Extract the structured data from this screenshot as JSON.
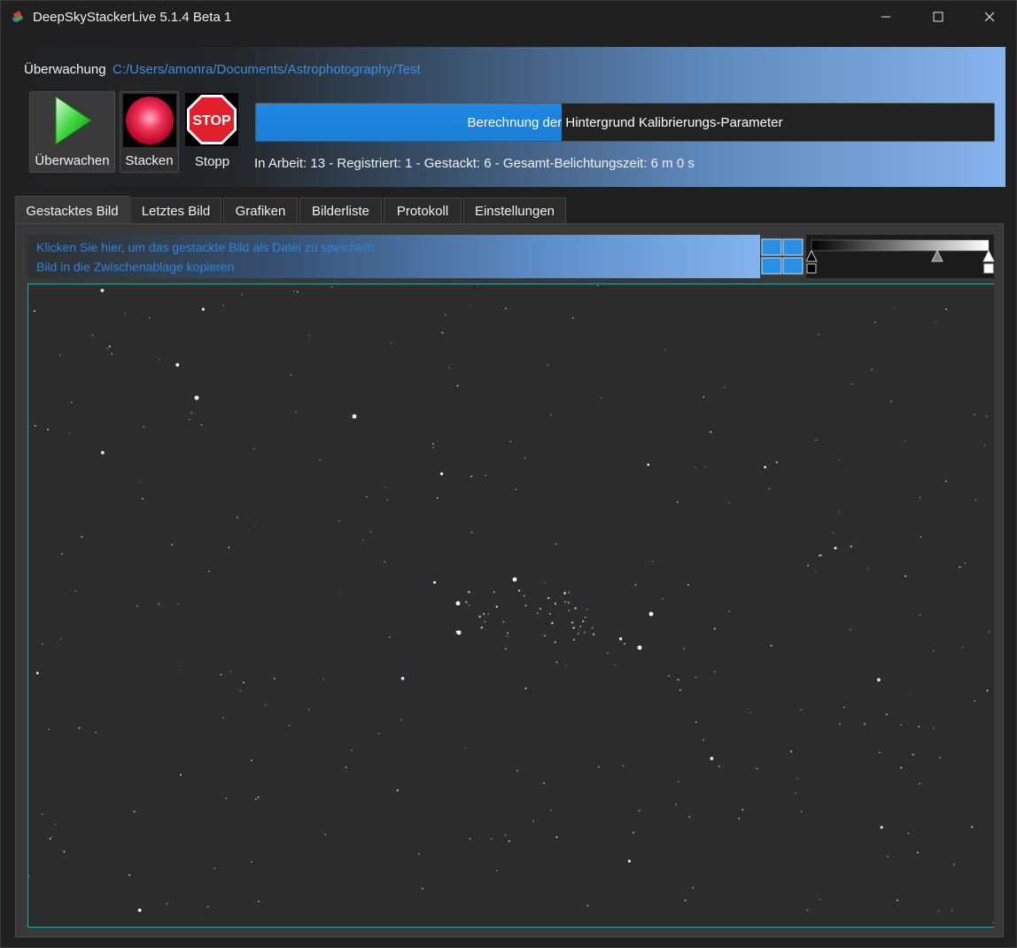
{
  "window": {
    "title": "DeepSkyStackerLive 5.1.4 Beta 1",
    "icons": {
      "logo": "dss-logo-icon",
      "minimize": "minimize-icon",
      "maximize": "maximize-icon",
      "close": "close-icon"
    }
  },
  "monitoring": {
    "label": "Überwachung",
    "folder_path": "C:/Users/amonra/Documents/Astrophotography/Test"
  },
  "toolbar": {
    "watch_label": "Überwachen",
    "stack_label": "Stacken",
    "stop_label": "Stopp",
    "stop_sign_text": "STOP",
    "icons": {
      "watch": "play-icon",
      "stack": "record-icon",
      "stop": "stop-sign-icon"
    }
  },
  "progress": {
    "text": "Berechnung der Hintergrund Kalibrierungs-Parameter",
    "fraction": 0.414
  },
  "status": {
    "text": "In Arbeit: 13 - Registriert: 1 - Gestackt: 6 - Gesamt-Belichtungszeit: 6 m 0 s"
  },
  "tabs": [
    {
      "label": "Gestacktes Bild",
      "active": true
    },
    {
      "label": "Letztes Bild",
      "active": false
    },
    {
      "label": "Grafiken",
      "active": false
    },
    {
      "label": "Bilderliste",
      "active": false
    },
    {
      "label": "Protokoll",
      "active": false
    },
    {
      "label": "Einstellungen",
      "active": false
    }
  ],
  "stacked_image": {
    "save_link": "Klicken Sie hier, um das gestackte Bild als Datei zu speichern",
    "copy_link": "Bild in die Zwischenablage kopieren",
    "view_icon": "four-panel-view-icon",
    "histogram": {
      "black_point": 0.0,
      "midtone": 0.71,
      "white_point": 1.0
    }
  },
  "colors": {
    "progress_fill": "#1e88e5",
    "link": "#2f84d8",
    "header_gradient_end": "#86b4ec",
    "image_background": "#2c2c2c",
    "image_border": "#2aa6a6"
  }
}
